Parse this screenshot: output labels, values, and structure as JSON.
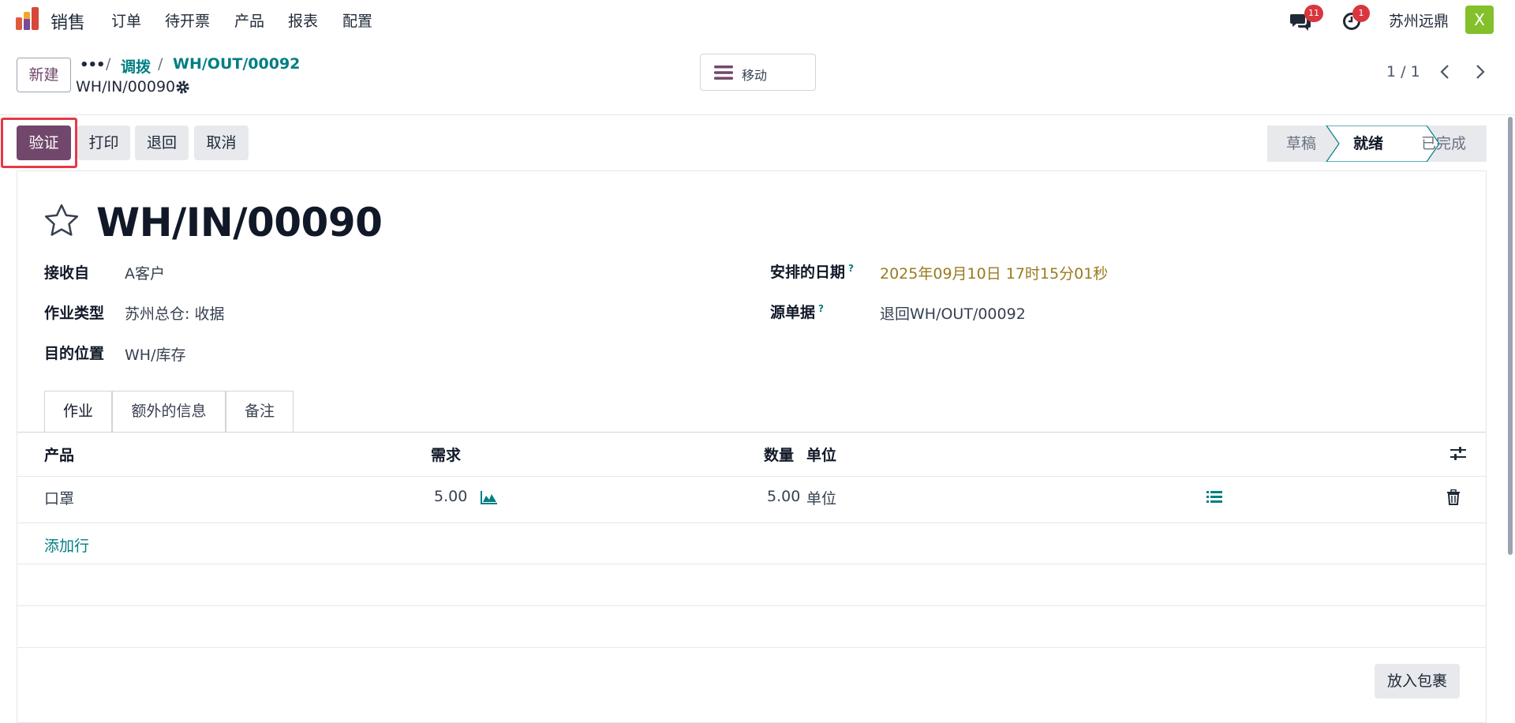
{
  "navbar": {
    "app_name": "销售",
    "menu": [
      "订单",
      "待开票",
      "产品",
      "报表",
      "配置"
    ],
    "messages_count": "11",
    "activities_count": "1",
    "company": "苏州远鼎",
    "avatar_initial": "X"
  },
  "control": {
    "new_label": "新建",
    "breadcrumb": [
      "调拨",
      "WH/OUT/00092"
    ],
    "current_record": "WH/IN/00090",
    "move_label": "移动",
    "pager": "1 / 1"
  },
  "actions": {
    "validate": "验证",
    "print": "打印",
    "return": "退回",
    "cancel": "取消"
  },
  "stages": [
    "草稿",
    "就绪",
    "已完成"
  ],
  "active_stage": "就绪",
  "record": {
    "title": "WH/IN/00090",
    "fields_left": [
      {
        "label": "接收自",
        "value": "A客户"
      },
      {
        "label": "作业类型",
        "value": "苏州总仓: 收据"
      },
      {
        "label": "目的位置",
        "value": "WH/库存"
      }
    ],
    "fields_right": [
      {
        "label": "安排的日期",
        "help": "?",
        "value": "2025年09月10日 17时15分01秒"
      },
      {
        "label": "源单据",
        "help": "?",
        "value": "退回WH/OUT/00092"
      }
    ]
  },
  "tabs": [
    "作业",
    "额外的信息",
    "备注"
  ],
  "table": {
    "headers": {
      "product": "产品",
      "demand": "需求",
      "quantity": "数量",
      "uom": "单位"
    },
    "rows": [
      {
        "product": "口罩",
        "demand": "5.00",
        "quantity": "5.00",
        "uom": "单位"
      }
    ],
    "add_line": "添加行"
  },
  "put_in_pack": "放入包裹",
  "colors": {
    "primary": "#71486b",
    "link": "#017e84",
    "highlight": "#e63946",
    "badge": "#d9363e"
  }
}
